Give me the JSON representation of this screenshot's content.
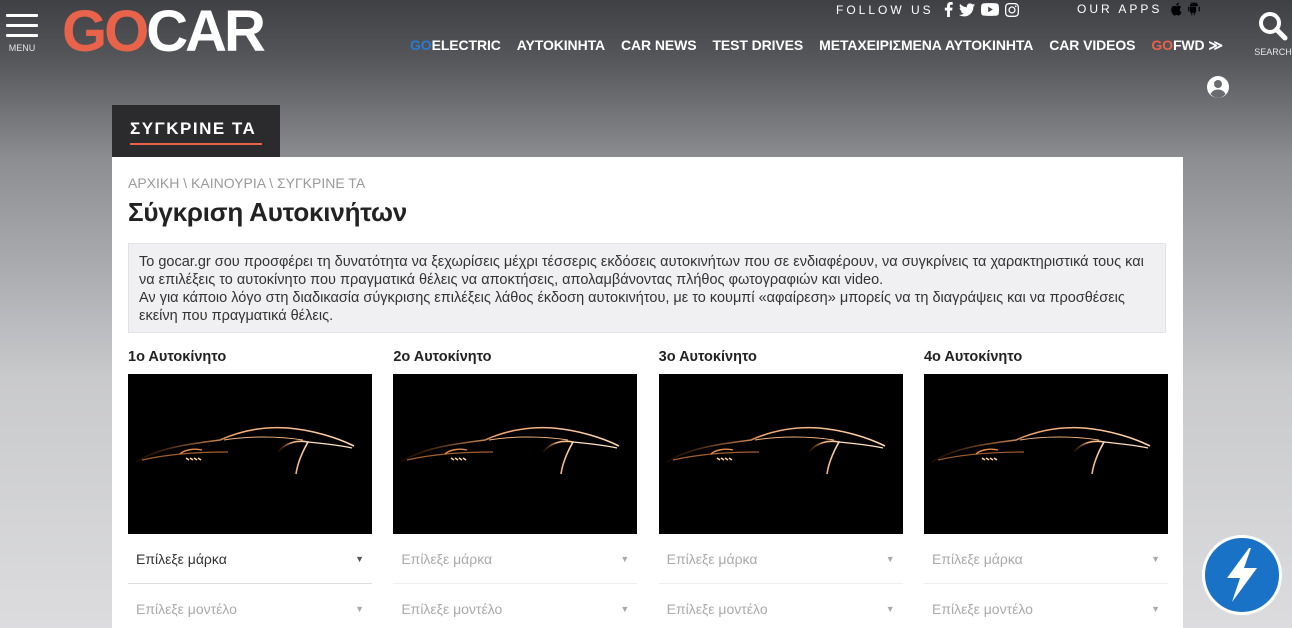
{
  "header": {
    "menu_label": "MENU",
    "logo_go": "GO",
    "logo_car": "CAR",
    "follow_label": "FOLLOW US",
    "apps_label": "OUR APPS",
    "search_label": "SEARCH",
    "nav": [
      {
        "prefix": "GO",
        "label": "ELECTRIC",
        "prefix_color": "#2a7bd5"
      },
      {
        "prefix": "",
        "label": "ΑΥΤΟΚΙΝΗΤΑ"
      },
      {
        "prefix": "",
        "label": "CAR NEWS"
      },
      {
        "prefix": "",
        "label": "TEST DRIVES"
      },
      {
        "prefix": "",
        "label": "ΜΕΤΑΧΕΙΡΙΣΜΕΝΑ ΑΥΤΟΚΙΝΗΤΑ"
      },
      {
        "prefix": "",
        "label": "CAR VIDEOS"
      },
      {
        "prefix": "GO",
        "label": "FWD ≫",
        "prefix_color": "#e8634a"
      }
    ]
  },
  "section_tab": "ΣΥΓΚΡΙΝΕ ΤΑ",
  "breadcrumb": [
    "ΑΡΧΙΚΗ",
    "ΚΑΙΝΟΥΡΙΑ",
    "ΣΥΓΚΡΙΝΕ ΤΑ"
  ],
  "breadcrumb_sep": " \\ ",
  "page_title": "Σύγκριση Αυτοκινήτων",
  "info": {
    "p1": "Το gocar.gr σου προσφέρει τη δυνατότητα να ξεχωρίσεις μέχρι τέσσερις εκδόσεις αυτοκινήτων που σε ενδιαφέρουν, να συγκρίνεις τα χαρακτηριστικά τους και να επιλέξεις το αυτοκίνητο που πραγματικά θέλεις να αποκτήσεις, απολαμβάνοντας πλήθος φωτογραφιών και video.",
    "p2": "Αν για κάποιο λόγο στη διαδικασία σύγκρισης επιλέξεις λάθος έκδοση αυτοκινήτου, με το κουμπί «αφαίρεση» μπορείς να τη διαγράψεις και να προσθέσεις εκείνη που πραγματικά θέλεις."
  },
  "cars": [
    {
      "heading": "1ο Αυτοκίνητο",
      "brand_placeholder": "Επίλεξε μάρκα",
      "model_placeholder": "Επίλεξε μοντέλο"
    },
    {
      "heading": "2ο Αυτοκίνητο",
      "brand_placeholder": "Επίλεξε μάρκα",
      "model_placeholder": "Επίλεξε μοντέλο"
    },
    {
      "heading": "3ο Αυτοκίνητο",
      "brand_placeholder": "Επίλεξε μάρκα",
      "model_placeholder": "Επίλεξε μοντέλο"
    },
    {
      "heading": "4ο Αυτοκίνητο",
      "brand_placeholder": "Επίλεξε μάρκα",
      "model_placeholder": "Επίλεξε μοντέλο"
    }
  ],
  "colors": {
    "brand_red": "#e8634a",
    "brand_blue": "#2a7bd5",
    "bolt_blue": "#1a72c6"
  },
  "icons": {
    "menu": "hamburger-icon",
    "facebook": "facebook-icon",
    "twitter": "twitter-icon",
    "youtube": "youtube-icon",
    "instagram": "instagram-icon",
    "apple": "apple-icon",
    "android": "android-icon",
    "search": "search-icon",
    "user": "user-icon",
    "bolt": "lightning-bolt-icon"
  }
}
